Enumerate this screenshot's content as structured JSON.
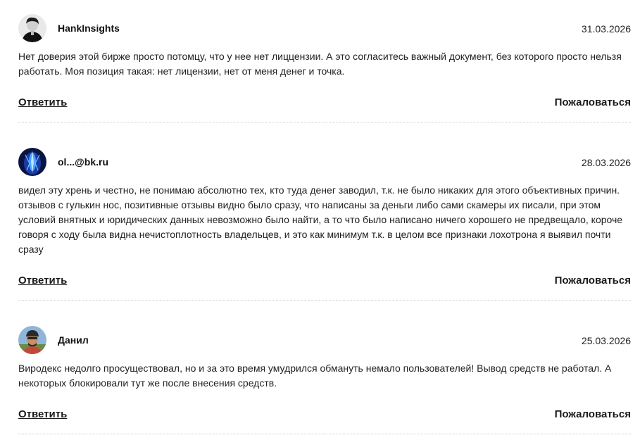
{
  "comments": [
    {
      "author": "HankInsights",
      "date": "31.03.2026",
      "avatar": "avatar-person-dark-hair",
      "text": "Нет доверия этой бирже просто потомцу, что у нее нет лиццензии. А это согласитесь важный документ, без которого просто нельзя работать. Моя позиция такая: нет лицензии, нет от меня денег и точка.",
      "reply_label": "Ответить",
      "report_label": "Пожаловаться"
    },
    {
      "author": "ol...@bk.ru",
      "date": "28.03.2026",
      "avatar": "avatar-blue-abstract",
      "text": "видел эту хрень и честно, не понимаю абсолютно тех, кто туда денег заводил, т.к. не было никаких для этого объективных причин. отзывов с гулькин нос, позитивные отзывы видно было сразу, что написаны за деньги либо сами скамеры их писали, при этом условий внятных и юридических данных невозможно было найти, а то что было написано ничего хорошего не предвещало, короче говоря с ходу была видна нечистоплотность владельцев, и это как минимум т.к. в целом все признаки лохотрона я выявил почти сразу",
      "reply_label": "Ответить",
      "report_label": "Пожаловаться"
    },
    {
      "author": "Данил",
      "date": "25.03.2026",
      "avatar": "avatar-person-cap",
      "text": "Виродекс недолго просуществовал, но и за это время умудрился обмануть немало пользователей! Вывод средств не работал. А некоторых блокировали тут же после внесения средств.",
      "reply_label": "Ответить",
      "report_label": "Пожаловаться"
    }
  ],
  "colors": {
    "text": "#222222",
    "divider": "#d6d6d6",
    "background": "#ffffff"
  }
}
